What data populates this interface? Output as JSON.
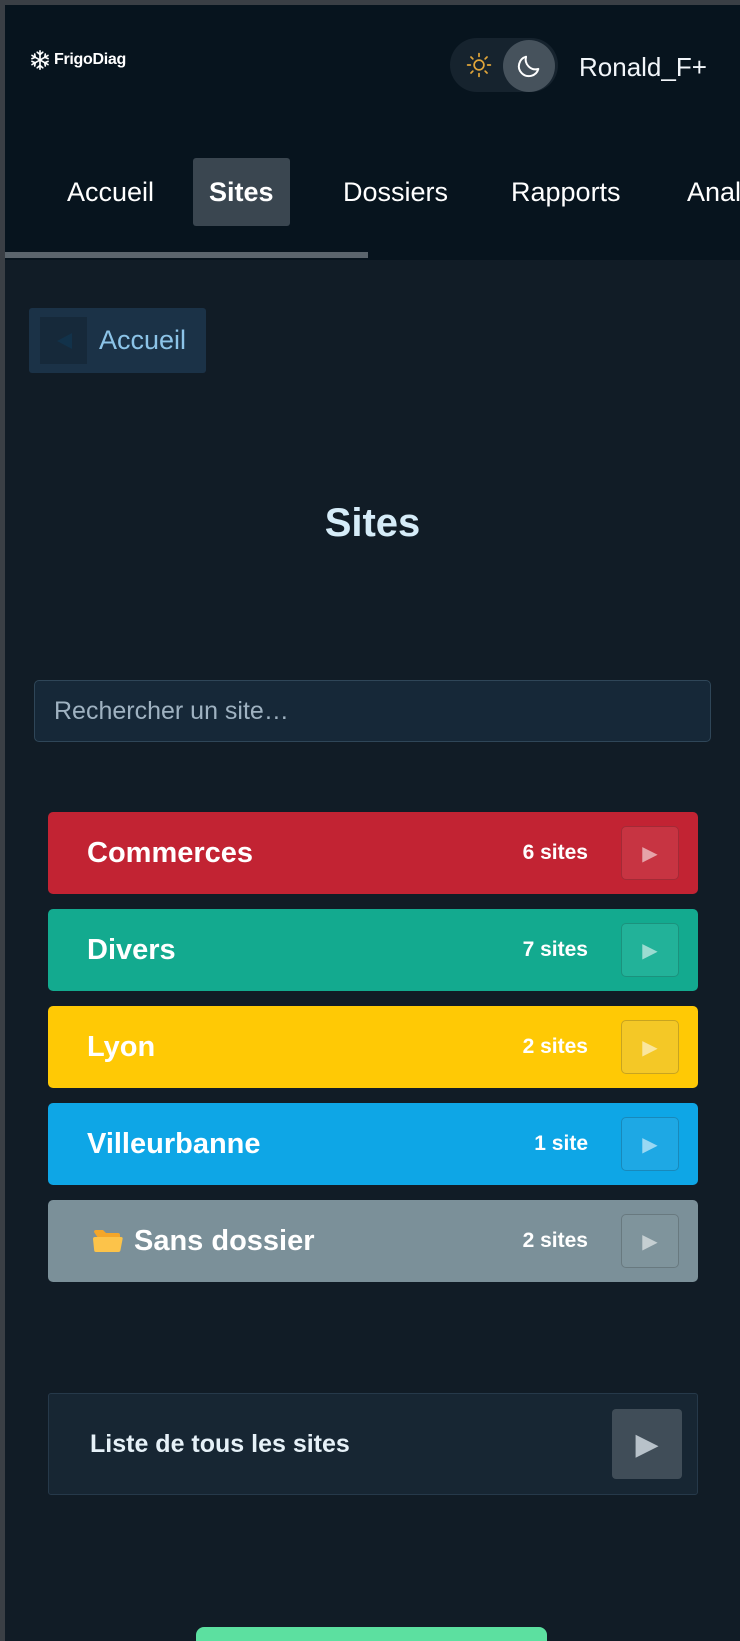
{
  "header": {
    "logo_text": "FrigoDiag",
    "username": "Ronald_F+",
    "theme": {
      "current": "dark"
    }
  },
  "nav": {
    "items": [
      {
        "label": "Accueil"
      },
      {
        "label": "Sites",
        "active": true
      },
      {
        "label": "Dossiers"
      },
      {
        "label": "Rapports"
      },
      {
        "label": "Anal"
      }
    ]
  },
  "back": {
    "label": "Accueil"
  },
  "page": {
    "title": "Sites"
  },
  "search": {
    "placeholder": "Rechercher un site…",
    "value": ""
  },
  "folders": [
    {
      "name": "Commerces",
      "count": "6 sites",
      "color": "#c22333"
    },
    {
      "name": "Divers",
      "count": "7 sites",
      "color": "#13aa8f"
    },
    {
      "name": "Lyon",
      "count": "2 sites",
      "color": "#ffc905"
    },
    {
      "name": "Villeurbanne",
      "count": "1 site",
      "color": "#0ea6e6"
    },
    {
      "name": "Sans dossier",
      "count": "2 sites",
      "color": "#7b9099",
      "icon": "folder-icon"
    }
  ],
  "all_sites": {
    "label": "Liste de tous les sites"
  }
}
